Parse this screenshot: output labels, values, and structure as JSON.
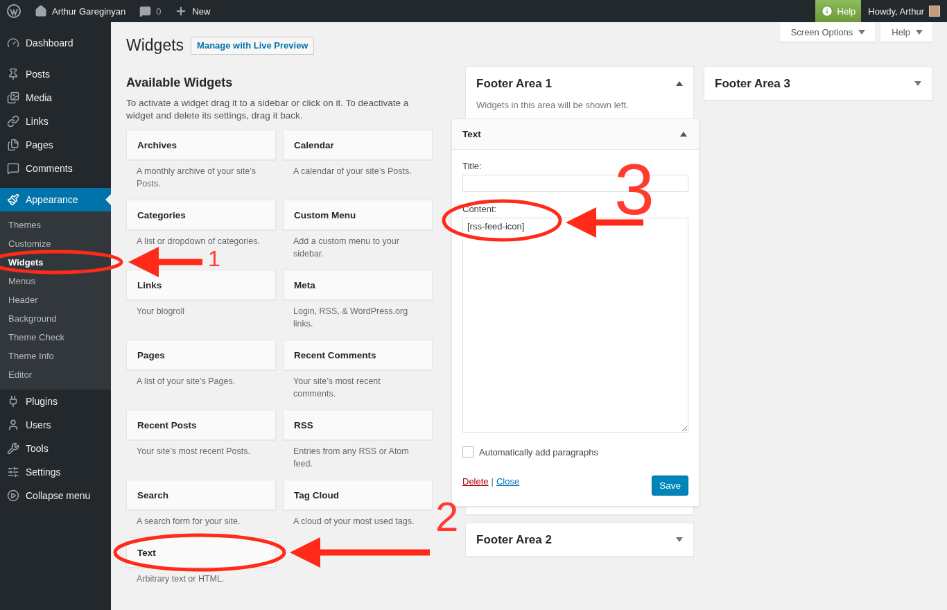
{
  "admin_bar": {
    "site_name": "Arthur Gareginyan",
    "comments_count": "0",
    "new_label": "New",
    "help_label": "Help",
    "greeting": "Howdy, Arthur"
  },
  "sidebar": {
    "items": [
      {
        "label": "Dashboard",
        "selected": false
      },
      {
        "label": "Posts",
        "selected": false
      },
      {
        "label": "Media",
        "selected": false
      },
      {
        "label": "Links",
        "selected": false
      },
      {
        "label": "Pages",
        "selected": false
      },
      {
        "label": "Comments",
        "selected": false
      },
      {
        "label": "Appearance",
        "selected": true,
        "children": [
          {
            "label": "Themes",
            "selected": false
          },
          {
            "label": "Customize",
            "selected": false
          },
          {
            "label": "Widgets",
            "selected": true
          },
          {
            "label": "Menus",
            "selected": false
          },
          {
            "label": "Header",
            "selected": false
          },
          {
            "label": "Background",
            "selected": false
          },
          {
            "label": "Theme Check",
            "selected": false
          },
          {
            "label": "Theme Info",
            "selected": false
          },
          {
            "label": "Editor",
            "selected": false
          }
        ]
      },
      {
        "label": "Plugins",
        "selected": false
      },
      {
        "label": "Users",
        "selected": false
      },
      {
        "label": "Tools",
        "selected": false
      },
      {
        "label": "Settings",
        "selected": false
      },
      {
        "label": "Collapse menu",
        "selected": false
      }
    ]
  },
  "screen_meta": [
    "Screen Options",
    "Help"
  ],
  "page": {
    "title": "Widgets",
    "action": "Manage with Live Preview"
  },
  "available": {
    "heading": "Available Widgets",
    "description": "To activate a widget drag it to a sidebar or click on it. To deactivate a widget and delete its settings, drag it back.",
    "widgets": [
      {
        "name": "Archives",
        "description": "A monthly archive of your site’s Posts."
      },
      {
        "name": "Calendar",
        "description": "A calendar of your site’s Posts."
      },
      {
        "name": "Categories",
        "description": "A list or dropdown of categories."
      },
      {
        "name": "Custom Menu",
        "description": "Add a custom menu to your sidebar."
      },
      {
        "name": "Links",
        "description": "Your blogroll"
      },
      {
        "name": "Meta",
        "description": "Login, RSS, & WordPress.org links."
      },
      {
        "name": "Pages",
        "description": "A list of your site’s Pages."
      },
      {
        "name": "Recent Comments",
        "description": "Your site’s most recent comments."
      },
      {
        "name": "Recent Posts",
        "description": "Your site’s most recent Posts."
      },
      {
        "name": "RSS",
        "description": "Entries from any RSS or Atom feed."
      },
      {
        "name": "Search",
        "description": "A search form for your site."
      },
      {
        "name": "Tag Cloud",
        "description": "A cloud of your most used tags."
      },
      {
        "name": "Text",
        "description": "Arbitrary text or HTML."
      }
    ]
  },
  "widget_area_columns": [
    {
      "areas": [
        {
          "title": "Footer Area 1",
          "expanded": true,
          "description": "Widgets in this area will be shown left.",
          "widget": {
            "title": "Text",
            "expanded": true,
            "title_label": "Title:",
            "content_label": "Content:",
            "content_value": "[rss-feed-icon]",
            "checkbox": {
              "label": "Automatically add paragraphs",
              "checked": false
            },
            "delete_link": "Delete",
            "link_separator": "|",
            "close_link": "Close",
            "save_button": "Save"
          }
        },
        {
          "title": "Footer Area 2",
          "expanded": false
        }
      ]
    },
    {
      "areas": [
        {
          "title": "Footer Area 3",
          "expanded": false
        }
      ]
    }
  ],
  "annotations": [
    {
      "number": "1"
    },
    {
      "number": "2"
    },
    {
      "number": "3"
    }
  ]
}
